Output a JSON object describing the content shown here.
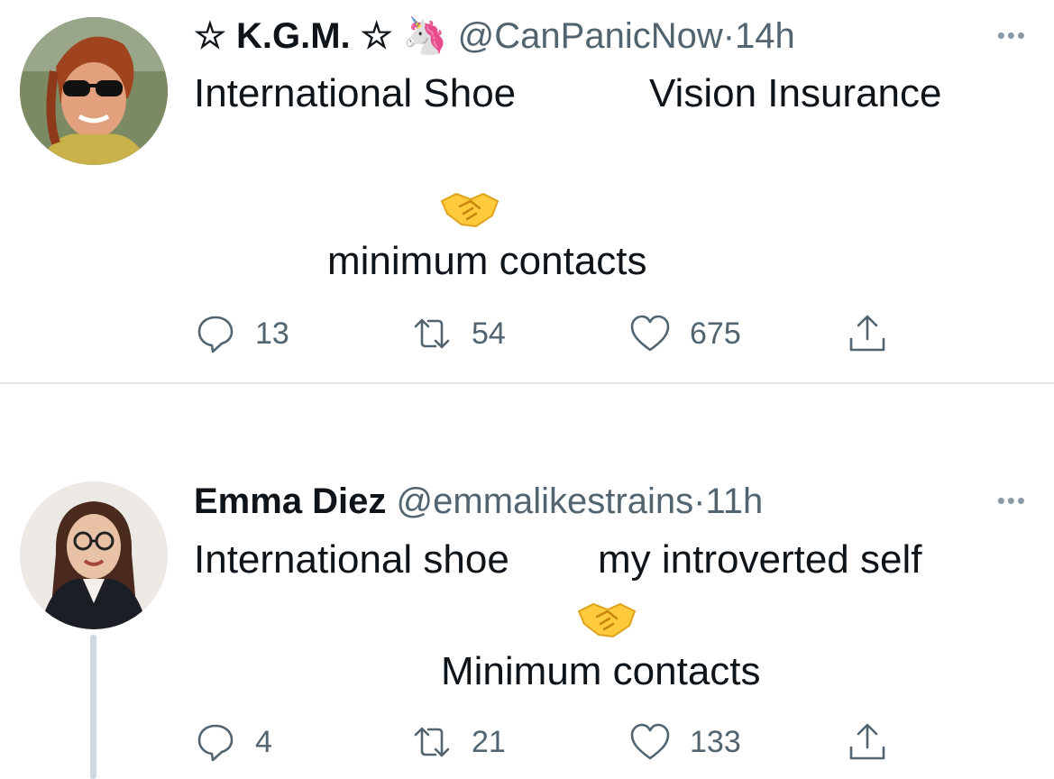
{
  "tweets": [
    {
      "display_name": "☆ K.G.M. ☆",
      "name_emoji": "🦄",
      "handle": "@CanPanicNow",
      "separator": "·",
      "time": "14h",
      "more_label": "•••",
      "text_left": "International Shoe",
      "text_right": "Vision Insurance",
      "emoji": "handshake",
      "text_bottom": "minimum contacts",
      "replies": "13",
      "retweets": "54",
      "likes": "675"
    },
    {
      "display_name": "Emma Diez",
      "handle": "@emmalikestrains",
      "separator": "·",
      "time": "11h",
      "more_label": "•••",
      "text_left": "International shoe",
      "text_right": "my introverted self",
      "emoji": "handshake",
      "text_bottom": "Minimum contacts",
      "replies": "4",
      "retweets": "21",
      "likes": "133"
    }
  ],
  "colors": {
    "text": "#0f1419",
    "secondary": "#536471",
    "divider": "#e3e6e8",
    "thread_line": "#cfd9de"
  }
}
